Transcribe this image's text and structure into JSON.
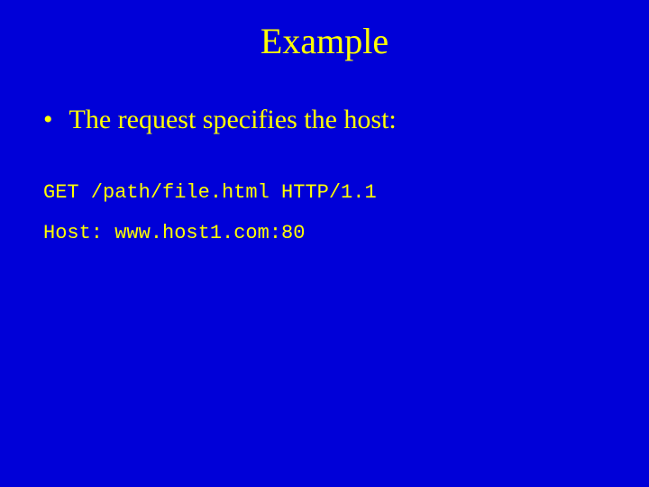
{
  "slide": {
    "title": "Example",
    "bullet": {
      "text": "The request specifies the host:"
    },
    "code": {
      "line1": "GET /path/file.html HTTP/1.1",
      "line2": "Host: www.host1.com:80"
    }
  }
}
